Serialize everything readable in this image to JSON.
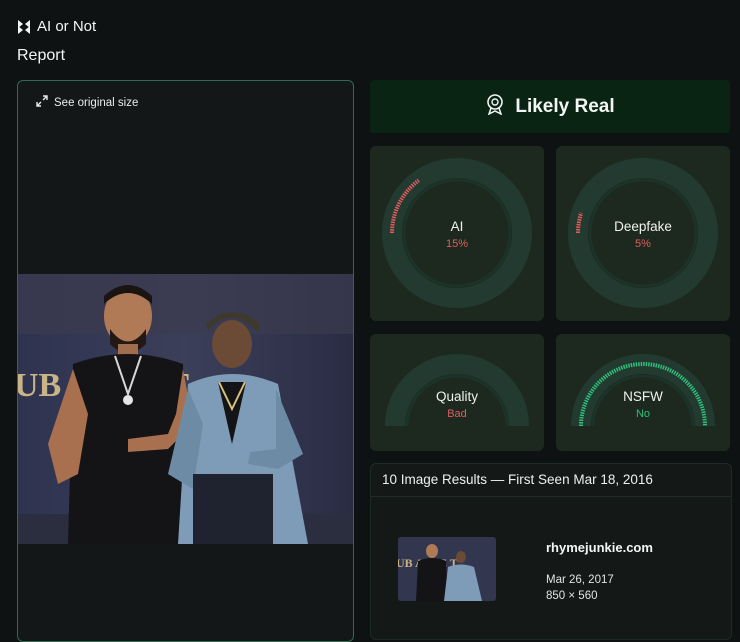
{
  "app": {
    "name": "AI or Not",
    "page_title": "Report"
  },
  "image_panel": {
    "see_original_label": "See original size",
    "photo_banner_text": "UB  AUSE T"
  },
  "verdict": {
    "label": "Likely Real"
  },
  "gauges": [
    {
      "key": "ai",
      "label": "AI",
      "value_text": "15%",
      "fraction": 0.15,
      "color": "#e25c5c"
    },
    {
      "key": "deepfake",
      "label": "Deepfake",
      "value_text": "5%",
      "fraction": 0.05,
      "color": "#e25c5c"
    },
    {
      "key": "quality",
      "label": "Quality",
      "value_text": "Bad",
      "fraction": 0,
      "color": "#e25c5c"
    },
    {
      "key": "nsfw",
      "label": "NSFW",
      "value_text": "No",
      "fraction": 1,
      "color": "#2fbf7a"
    }
  ],
  "results": {
    "header": "10 Image Results — First Seen Mar 18, 2016",
    "items": [
      {
        "site": "rhymejunkie.com",
        "date": "Mar 26, 2017",
        "dimensions": "850 × 560"
      }
    ]
  },
  "colors": {
    "accent": "#2fbf7a",
    "warning": "#e25c5c",
    "verdict_bg": "#0a2414",
    "card_bg": "#1d291f"
  }
}
